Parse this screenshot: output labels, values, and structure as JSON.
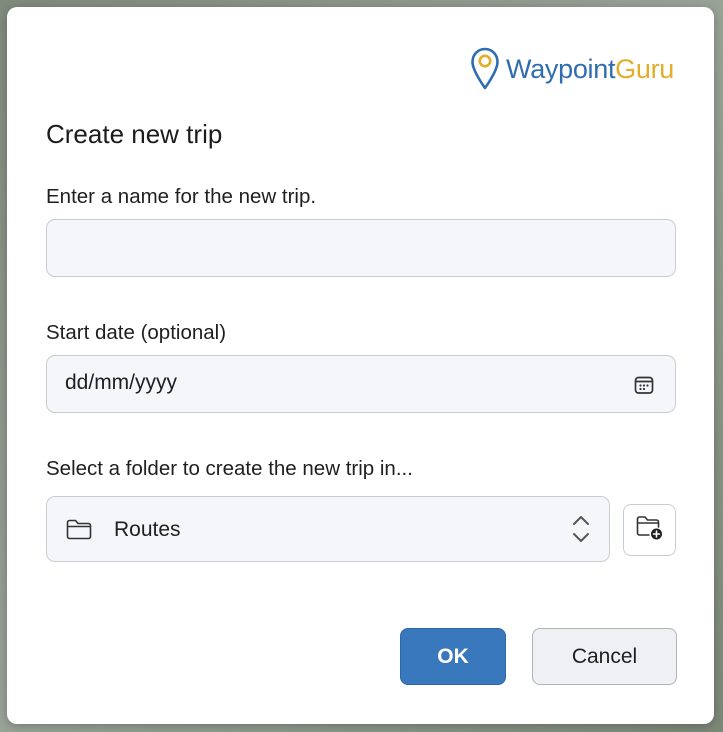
{
  "logo": {
    "wordmark_part1": "Waypoint",
    "wordmark_part2": "Guru",
    "icon": "map-pin-icon"
  },
  "dialog": {
    "title": "Create new trip",
    "name_label": "Enter a name for the new trip.",
    "name_value": "",
    "date_label": "Start date (optional)",
    "date_placeholder": "dd/mm/yyyy",
    "date_icon": "calendar-icon",
    "folder_label": "Select a folder to create the new trip in...",
    "folder_selected": "Routes",
    "folder_icon": "folder-icon",
    "select_icon": "chevron-up-down-icon",
    "new_folder_icon": "folder-add-icon",
    "ok_label": "OK",
    "cancel_label": "Cancel"
  },
  "colors": {
    "brand_blue": "#2f6db1",
    "brand_gold": "#e2ad29",
    "primary_button": "#3a78bd",
    "field_background": "#f4f6f9"
  }
}
